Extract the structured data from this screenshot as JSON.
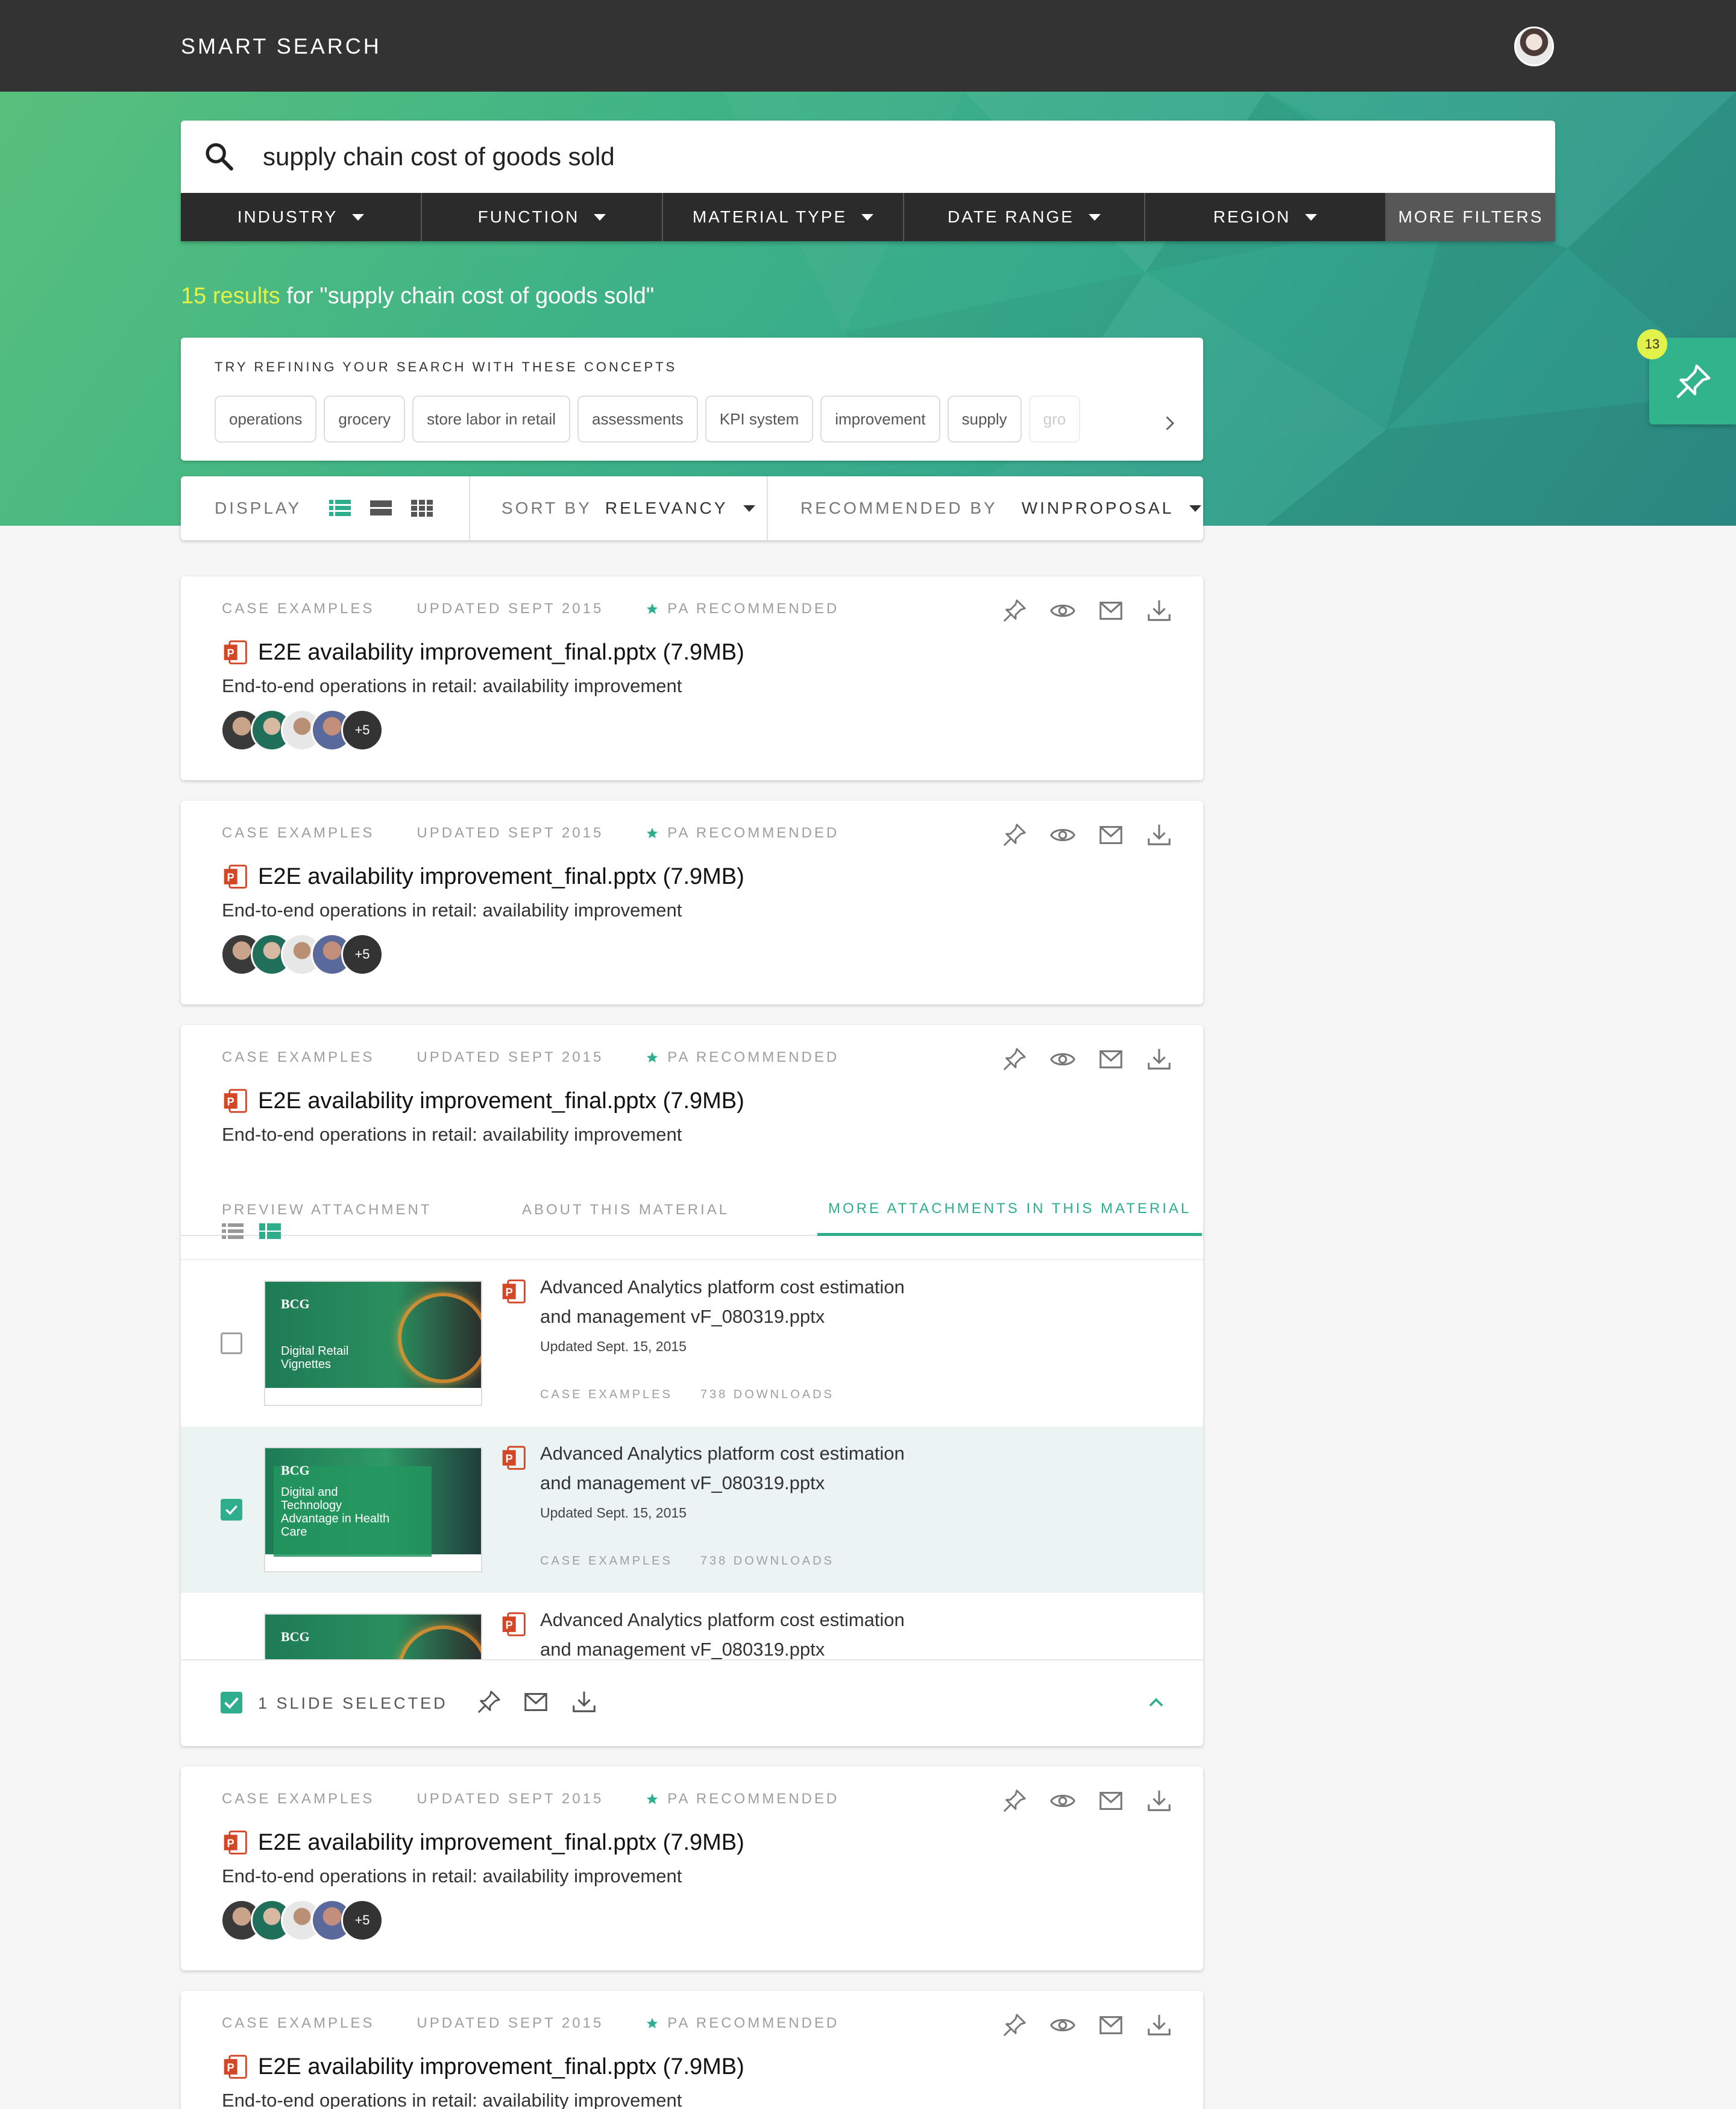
{
  "app": {
    "title": "SMART SEARCH"
  },
  "search": {
    "query": "supply chain cost of goods sold"
  },
  "filters": {
    "industry": "INDUSTRY",
    "function": "FUNCTION",
    "material_type": "MATERIAL TYPE",
    "date_range": "DATE RANGE",
    "region": "REGION",
    "more": "MORE FILTERS"
  },
  "results": {
    "count_text": "15 results",
    "for_text": " for \"supply chain cost of goods sold\""
  },
  "concepts": {
    "label": "TRY REFINING YOUR SEARCH WITH THESE CONCEPTS",
    "chips": [
      "operations",
      "grocery",
      "store labor in retail",
      "assessments",
      "KPI system",
      "improvement",
      "supply",
      "gro"
    ]
  },
  "display_bar": {
    "display_label": "DISPLAY",
    "sort_label": "SORT BY",
    "sort_value": "RELEVANCY",
    "rec_label": "RECOMMENDED BY",
    "rec_value": "WINPROPOSAL"
  },
  "pinboard": {
    "count": "13"
  },
  "result_cards": [
    {
      "category": "CASE EXAMPLES",
      "updated": "UPDATED SEPT 2015",
      "recommended": "PA RECOMMENDED",
      "title": "E2E availability improvement_final.pptx (7.9MB)",
      "subtitle": "End-to-end operations in retail: availability improvement",
      "more_people": "+5"
    },
    {
      "category": "CASE EXAMPLES",
      "updated": "UPDATED SEPT 2015",
      "recommended": "PA RECOMMENDED",
      "title": "E2E availability improvement_final.pptx (7.9MB)",
      "subtitle": "End-to-end operations in retail: availability improvement",
      "more_people": "+5"
    },
    {
      "category": "CASE EXAMPLES",
      "updated": "UPDATED SEPT 2015",
      "recommended": "PA RECOMMENDED",
      "title": "E2E availability improvement_final.pptx (7.9MB)",
      "subtitle": "End-to-end operations in retail: availability improvement"
    },
    {
      "category": "CASE EXAMPLES",
      "updated": "UPDATED SEPT 2015",
      "recommended": "PA RECOMMENDED",
      "title": "E2E availability improvement_final.pptx (7.9MB)",
      "subtitle": "End-to-end operations in retail: availability improvement",
      "more_people": "+5"
    },
    {
      "category": "CASE EXAMPLES",
      "updated": "UPDATED SEPT 2015",
      "recommended": "PA RECOMMENDED",
      "title": "E2E availability improvement_final.pptx (7.9MB)",
      "subtitle": "End-to-end operations in retail: availability improvement"
    }
  ],
  "expanded": {
    "tabs": [
      "PREVIEW ATTACHMENT",
      "ABOUT THIS MATERIAL",
      "MORE ATTACHMENTS IN THIS MATERIAL"
    ],
    "attachments": [
      {
        "title_line1": "Advanced Analytics platform cost estimation",
        "title_line2": "and management vF_080319.pptx",
        "updated": "Updated Sept. 15, 2015",
        "category": "CASE EXAMPLES",
        "downloads": "738 DOWNLOADS",
        "thumb_brand": "BCG",
        "thumb_title": [
          "Digital Retail",
          "Vignettes"
        ],
        "selected": false
      },
      {
        "title_line1": "Advanced Analytics platform cost estimation",
        "title_line2": "and management vF_080319.pptx",
        "updated": "Updated Sept. 15, 2015",
        "category": "CASE EXAMPLES",
        "downloads": "738 DOWNLOADS",
        "thumb_brand": "BCG",
        "thumb_title": [
          "Digital and",
          "Technology",
          "Advantage in Health",
          "Care"
        ],
        "selected": true
      },
      {
        "title_line1": "Advanced Analytics platform cost estimation",
        "title_line2": "and management vF_080319.pptx",
        "thumb_brand": "BCG"
      }
    ],
    "selected_label": "1 SLIDE SELECTED"
  },
  "colors": {
    "accent": "#2fae8d",
    "highlight": "#e3f24a",
    "topbar": "#333333",
    "filterbar": "#2b2b2b",
    "powerpoint": "#d24726"
  }
}
